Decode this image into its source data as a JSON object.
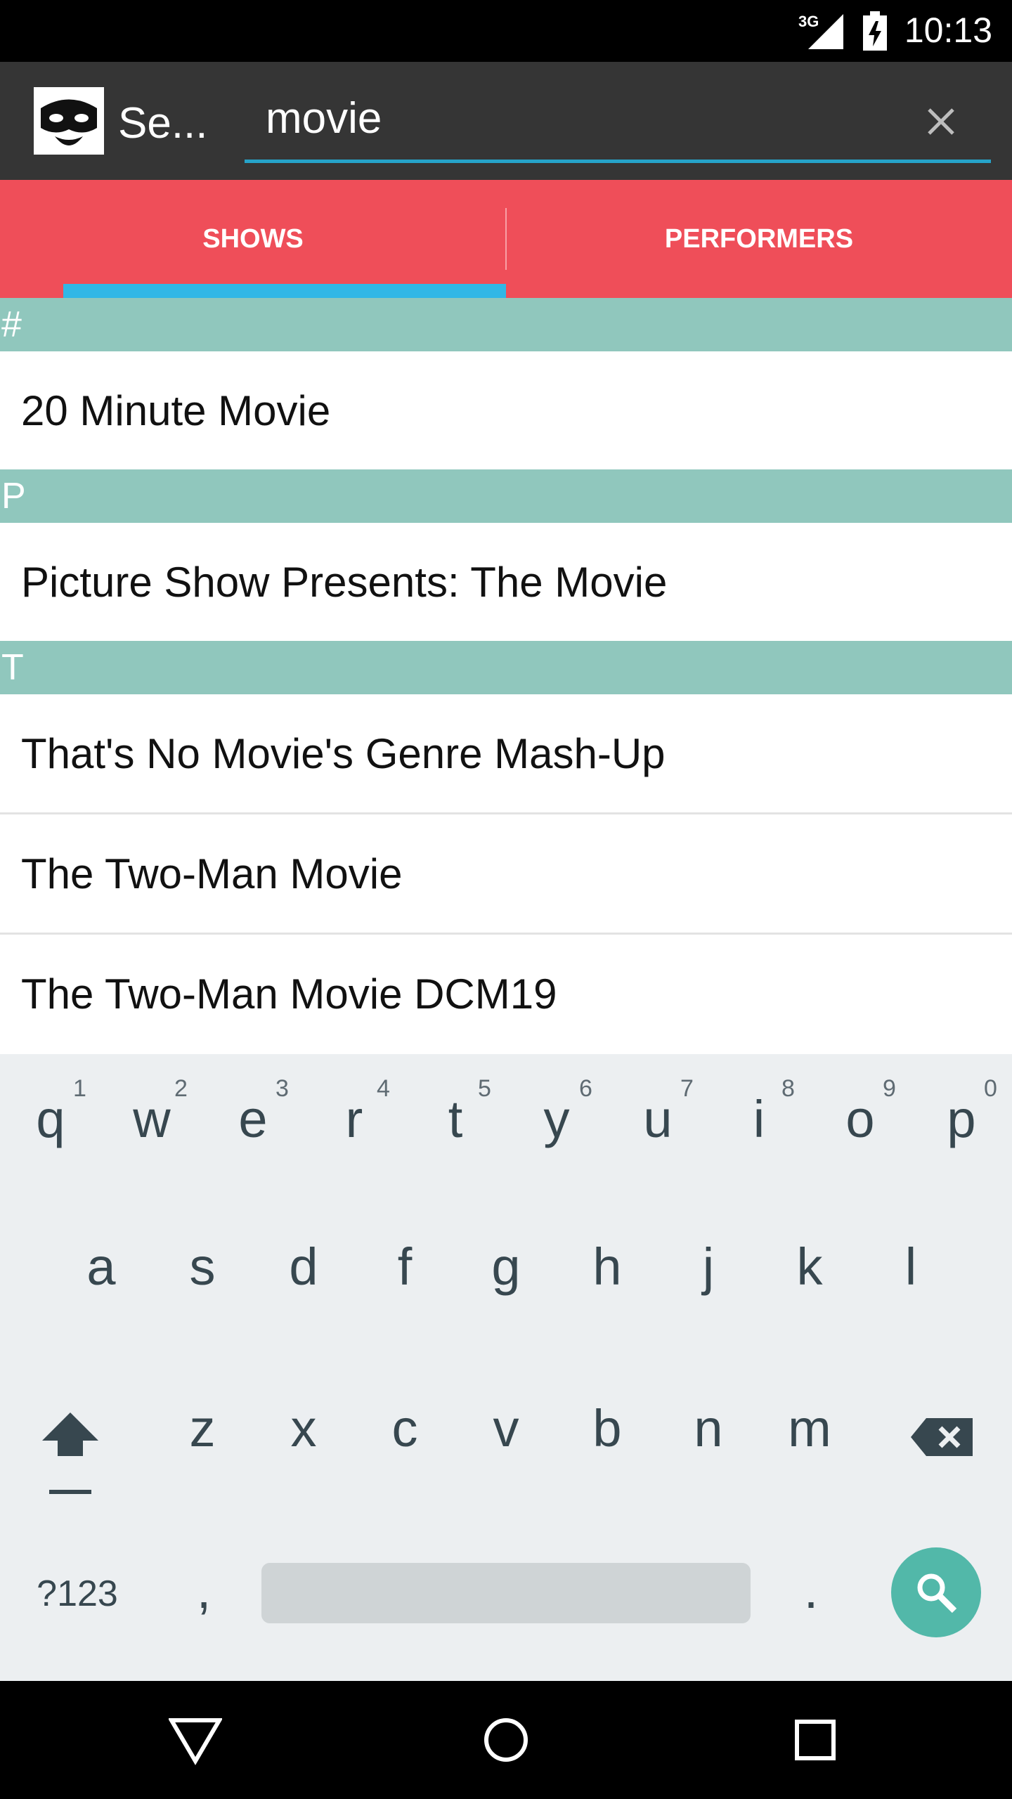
{
  "status_bar": {
    "network": "3G",
    "time": "10:13"
  },
  "app_bar": {
    "title": "Se...",
    "search_value": "movie",
    "logo_icon": "mask-logo-icon",
    "clear_icon": "close-icon"
  },
  "tabs": [
    {
      "label": "SHOWS",
      "selected": true
    },
    {
      "label": "PERFORMERS",
      "selected": false
    }
  ],
  "results": [
    {
      "section": "#",
      "items": [
        "20 Minute Movie"
      ]
    },
    {
      "section": "P",
      "items": [
        "Picture Show Presents: The Movie"
      ]
    },
    {
      "section": "T",
      "items": [
        "That's No Movie's Genre Mash-Up",
        "The Two-Man Movie",
        "The Two-Man Movie DCM19"
      ]
    }
  ],
  "keyboard": {
    "row1": [
      "q",
      "w",
      "e",
      "r",
      "t",
      "y",
      "u",
      "i",
      "o",
      "p"
    ],
    "row1_hints": [
      "1",
      "2",
      "3",
      "4",
      "5",
      "6",
      "7",
      "8",
      "9",
      "0"
    ],
    "row2": [
      "a",
      "s",
      "d",
      "f",
      "g",
      "h",
      "j",
      "k",
      "l"
    ],
    "row3": [
      "z",
      "x",
      "c",
      "v",
      "b",
      "n",
      "m"
    ],
    "symbols_label": "?123",
    "comma": ",",
    "period": ".",
    "shift_icon": "shift-icon",
    "backspace_icon": "backspace-icon",
    "search_icon": "search-icon"
  },
  "navigation": {
    "back_icon": "back-icon",
    "home_icon": "home-icon",
    "recents_icon": "recents-icon"
  },
  "colors": {
    "app_bar": "#353535",
    "tab_bar": "#ef4e59",
    "tab_indicator": "#31b7e6",
    "section_header": "#90c7bd",
    "search_key": "#52b8a9"
  }
}
